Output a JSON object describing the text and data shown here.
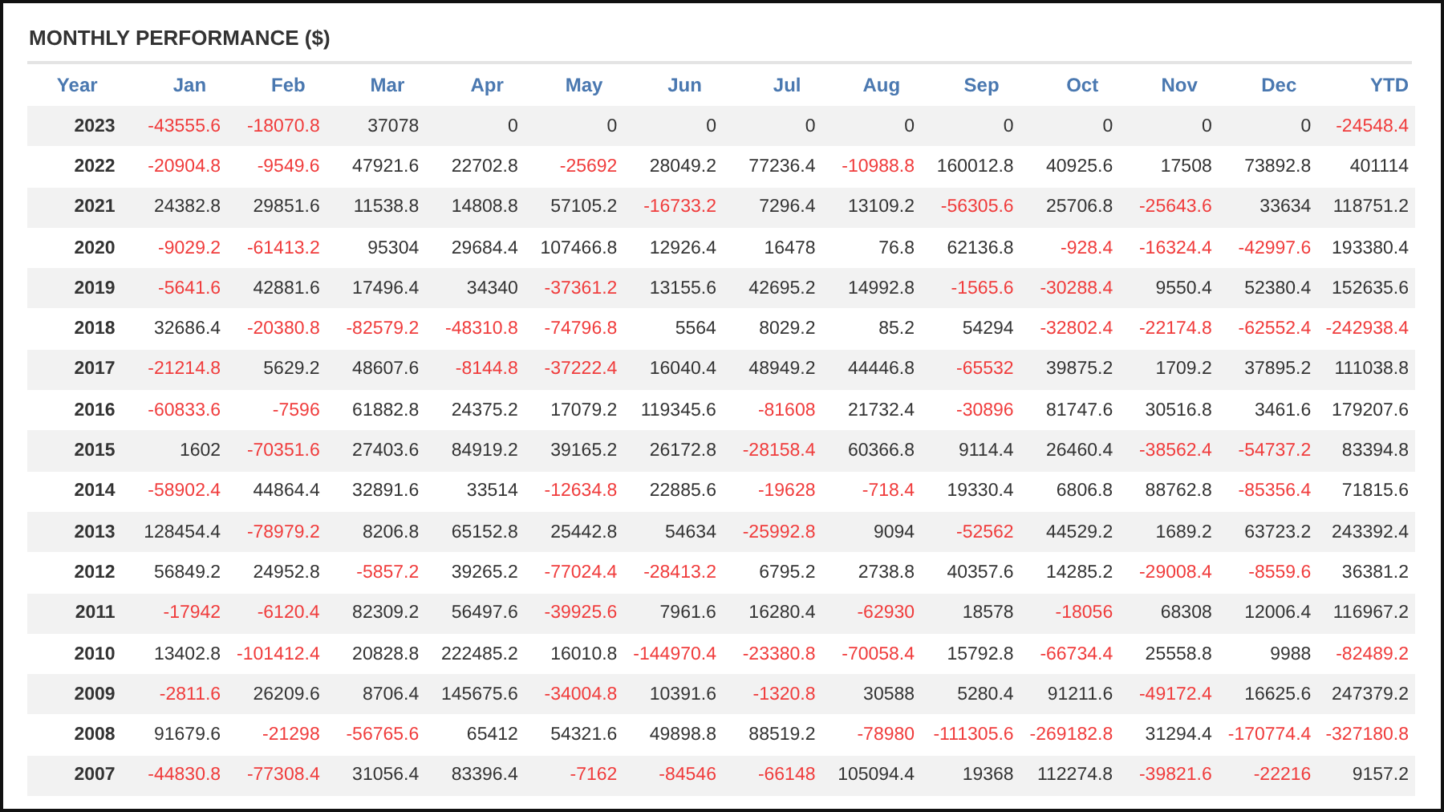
{
  "title": "MONTHLY PERFORMANCE ($)",
  "columns": [
    "Year",
    "Jan",
    "Feb",
    "Mar",
    "Apr",
    "May",
    "Jun",
    "Jul",
    "Aug",
    "Sep",
    "Oct",
    "Nov",
    "Dec",
    "YTD"
  ],
  "rows": [
    {
      "year": "2023",
      "cells": [
        {
          "value": "-43555.6",
          "negative": true
        },
        {
          "value": "-18070.8",
          "negative": true
        },
        {
          "value": "37078",
          "negative": false
        },
        {
          "value": "0",
          "negative": false
        },
        {
          "value": "0",
          "negative": false
        },
        {
          "value": "0",
          "negative": false
        },
        {
          "value": "0",
          "negative": false
        },
        {
          "value": "0",
          "negative": false
        },
        {
          "value": "0",
          "negative": false
        },
        {
          "value": "0",
          "negative": false
        },
        {
          "value": "0",
          "negative": false
        },
        {
          "value": "0",
          "negative": false
        },
        {
          "value": "-24548.4",
          "negative": true
        }
      ]
    },
    {
      "year": "2022",
      "cells": [
        {
          "value": "-20904.8",
          "negative": true
        },
        {
          "value": "-9549.6",
          "negative": true
        },
        {
          "value": "47921.6",
          "negative": false
        },
        {
          "value": "22702.8",
          "negative": false
        },
        {
          "value": "-25692",
          "negative": true
        },
        {
          "value": "28049.2",
          "negative": false
        },
        {
          "value": "77236.4",
          "negative": false
        },
        {
          "value": "-10988.8",
          "negative": true
        },
        {
          "value": "160012.8",
          "negative": false
        },
        {
          "value": "40925.6",
          "negative": false
        },
        {
          "value": "17508",
          "negative": false
        },
        {
          "value": "73892.8",
          "negative": false
        },
        {
          "value": "401114",
          "negative": false
        }
      ]
    },
    {
      "year": "2021",
      "cells": [
        {
          "value": "24382.8",
          "negative": false
        },
        {
          "value": "29851.6",
          "negative": false
        },
        {
          "value": "11538.8",
          "negative": false
        },
        {
          "value": "14808.8",
          "negative": false
        },
        {
          "value": "57105.2",
          "negative": false
        },
        {
          "value": "-16733.2",
          "negative": true
        },
        {
          "value": "7296.4",
          "negative": false
        },
        {
          "value": "13109.2",
          "negative": false
        },
        {
          "value": "-56305.6",
          "negative": true
        },
        {
          "value": "25706.8",
          "negative": false
        },
        {
          "value": "-25643.6",
          "negative": true
        },
        {
          "value": "33634",
          "negative": false
        },
        {
          "value": "118751.2",
          "negative": false
        }
      ]
    },
    {
      "year": "2020",
      "cells": [
        {
          "value": "-9029.2",
          "negative": true
        },
        {
          "value": "-61413.2",
          "negative": true
        },
        {
          "value": "95304",
          "negative": false
        },
        {
          "value": "29684.4",
          "negative": false
        },
        {
          "value": "107466.8",
          "negative": false
        },
        {
          "value": "12926.4",
          "negative": false
        },
        {
          "value": "16478",
          "negative": false
        },
        {
          "value": "76.8",
          "negative": false
        },
        {
          "value": "62136.8",
          "negative": false
        },
        {
          "value": "-928.4",
          "negative": true
        },
        {
          "value": "-16324.4",
          "negative": true
        },
        {
          "value": "-42997.6",
          "negative": true
        },
        {
          "value": "193380.4",
          "negative": false
        }
      ]
    },
    {
      "year": "2019",
      "cells": [
        {
          "value": "-5641.6",
          "negative": true
        },
        {
          "value": "42881.6",
          "negative": false
        },
        {
          "value": "17496.4",
          "negative": false
        },
        {
          "value": "34340",
          "negative": false
        },
        {
          "value": "-37361.2",
          "negative": true
        },
        {
          "value": "13155.6",
          "negative": false
        },
        {
          "value": "42695.2",
          "negative": false
        },
        {
          "value": "14992.8",
          "negative": false
        },
        {
          "value": "-1565.6",
          "negative": true
        },
        {
          "value": "-30288.4",
          "negative": true
        },
        {
          "value": "9550.4",
          "negative": false
        },
        {
          "value": "52380.4",
          "negative": false
        },
        {
          "value": "152635.6",
          "negative": false
        }
      ]
    },
    {
      "year": "2018",
      "cells": [
        {
          "value": "32686.4",
          "negative": false
        },
        {
          "value": "-20380.8",
          "negative": true
        },
        {
          "value": "-82579.2",
          "negative": true
        },
        {
          "value": "-48310.8",
          "negative": true
        },
        {
          "value": "-74796.8",
          "negative": true
        },
        {
          "value": "5564",
          "negative": false
        },
        {
          "value": "8029.2",
          "negative": false
        },
        {
          "value": "85.2",
          "negative": false
        },
        {
          "value": "54294",
          "negative": false
        },
        {
          "value": "-32802.4",
          "negative": true
        },
        {
          "value": "-22174.8",
          "negative": true
        },
        {
          "value": "-62552.4",
          "negative": true
        },
        {
          "value": "-242938.4",
          "negative": true
        }
      ]
    },
    {
      "year": "2017",
      "cells": [
        {
          "value": "-21214.8",
          "negative": true
        },
        {
          "value": "5629.2",
          "negative": false
        },
        {
          "value": "48607.6",
          "negative": false
        },
        {
          "value": "-8144.8",
          "negative": true
        },
        {
          "value": "-37222.4",
          "negative": true
        },
        {
          "value": "16040.4",
          "negative": false
        },
        {
          "value": "48949.2",
          "negative": false
        },
        {
          "value": "44446.8",
          "negative": false
        },
        {
          "value": "-65532",
          "negative": true
        },
        {
          "value": "39875.2",
          "negative": false
        },
        {
          "value": "1709.2",
          "negative": false
        },
        {
          "value": "37895.2",
          "negative": false
        },
        {
          "value": "111038.8",
          "negative": false
        }
      ]
    },
    {
      "year": "2016",
      "cells": [
        {
          "value": "-60833.6",
          "negative": true
        },
        {
          "value": "-7596",
          "negative": true
        },
        {
          "value": "61882.8",
          "negative": false
        },
        {
          "value": "24375.2",
          "negative": false
        },
        {
          "value": "17079.2",
          "negative": false
        },
        {
          "value": "119345.6",
          "negative": false
        },
        {
          "value": "-81608",
          "negative": true
        },
        {
          "value": "21732.4",
          "negative": false
        },
        {
          "value": "-30896",
          "negative": true
        },
        {
          "value": "81747.6",
          "negative": false
        },
        {
          "value": "30516.8",
          "negative": false
        },
        {
          "value": "3461.6",
          "negative": false
        },
        {
          "value": "179207.6",
          "negative": false
        }
      ]
    },
    {
      "year": "2015",
      "cells": [
        {
          "value": "1602",
          "negative": false
        },
        {
          "value": "-70351.6",
          "negative": true
        },
        {
          "value": "27403.6",
          "negative": false
        },
        {
          "value": "84919.2",
          "negative": false
        },
        {
          "value": "39165.2",
          "negative": false
        },
        {
          "value": "26172.8",
          "negative": false
        },
        {
          "value": "-28158.4",
          "negative": true
        },
        {
          "value": "60366.8",
          "negative": false
        },
        {
          "value": "9114.4",
          "negative": false
        },
        {
          "value": "26460.4",
          "negative": false
        },
        {
          "value": "-38562.4",
          "negative": true
        },
        {
          "value": "-54737.2",
          "negative": true
        },
        {
          "value": "83394.8",
          "negative": false
        }
      ]
    },
    {
      "year": "2014",
      "cells": [
        {
          "value": "-58902.4",
          "negative": true
        },
        {
          "value": "44864.4",
          "negative": false
        },
        {
          "value": "32891.6",
          "negative": false
        },
        {
          "value": "33514",
          "negative": false
        },
        {
          "value": "-12634.8",
          "negative": true
        },
        {
          "value": "22885.6",
          "negative": false
        },
        {
          "value": "-19628",
          "negative": true
        },
        {
          "value": "-718.4",
          "negative": true
        },
        {
          "value": "19330.4",
          "negative": false
        },
        {
          "value": "6806.8",
          "negative": false
        },
        {
          "value": "88762.8",
          "negative": false
        },
        {
          "value": "-85356.4",
          "negative": true
        },
        {
          "value": "71815.6",
          "negative": false
        }
      ]
    },
    {
      "year": "2013",
      "cells": [
        {
          "value": "128454.4",
          "negative": false
        },
        {
          "value": "-78979.2",
          "negative": true
        },
        {
          "value": "8206.8",
          "negative": false
        },
        {
          "value": "65152.8",
          "negative": false
        },
        {
          "value": "25442.8",
          "negative": false
        },
        {
          "value": "54634",
          "negative": false
        },
        {
          "value": "-25992.8",
          "negative": true
        },
        {
          "value": "9094",
          "negative": false
        },
        {
          "value": "-52562",
          "negative": true
        },
        {
          "value": "44529.2",
          "negative": false
        },
        {
          "value": "1689.2",
          "negative": false
        },
        {
          "value": "63723.2",
          "negative": false
        },
        {
          "value": "243392.4",
          "negative": false
        }
      ]
    },
    {
      "year": "2012",
      "cells": [
        {
          "value": "56849.2",
          "negative": false
        },
        {
          "value": "24952.8",
          "negative": false
        },
        {
          "value": "-5857.2",
          "negative": true
        },
        {
          "value": "39265.2",
          "negative": false
        },
        {
          "value": "-77024.4",
          "negative": true
        },
        {
          "value": "-28413.2",
          "negative": true
        },
        {
          "value": "6795.2",
          "negative": false
        },
        {
          "value": "2738.8",
          "negative": false
        },
        {
          "value": "40357.6",
          "negative": false
        },
        {
          "value": "14285.2",
          "negative": false
        },
        {
          "value": "-29008.4",
          "negative": true
        },
        {
          "value": "-8559.6",
          "negative": true
        },
        {
          "value": "36381.2",
          "negative": false
        }
      ]
    },
    {
      "year": "2011",
      "cells": [
        {
          "value": "-17942",
          "negative": true
        },
        {
          "value": "-6120.4",
          "negative": true
        },
        {
          "value": "82309.2",
          "negative": false
        },
        {
          "value": "56497.6",
          "negative": false
        },
        {
          "value": "-39925.6",
          "negative": true
        },
        {
          "value": "7961.6",
          "negative": false
        },
        {
          "value": "16280.4",
          "negative": false
        },
        {
          "value": "-62930",
          "negative": true
        },
        {
          "value": "18578",
          "negative": false
        },
        {
          "value": "-18056",
          "negative": true
        },
        {
          "value": "68308",
          "negative": false
        },
        {
          "value": "12006.4",
          "negative": false
        },
        {
          "value": "116967.2",
          "negative": false
        }
      ]
    },
    {
      "year": "2010",
      "cells": [
        {
          "value": "13402.8",
          "negative": false
        },
        {
          "value": "-101412.4",
          "negative": true
        },
        {
          "value": "20828.8",
          "negative": false
        },
        {
          "value": "222485.2",
          "negative": false
        },
        {
          "value": "16010.8",
          "negative": false
        },
        {
          "value": "-144970.4",
          "negative": true
        },
        {
          "value": "-23380.8",
          "negative": true
        },
        {
          "value": "-70058.4",
          "negative": true
        },
        {
          "value": "15792.8",
          "negative": false
        },
        {
          "value": "-66734.4",
          "negative": true
        },
        {
          "value": "25558.8",
          "negative": false
        },
        {
          "value": "9988",
          "negative": false
        },
        {
          "value": "-82489.2",
          "negative": true
        }
      ]
    },
    {
      "year": "2009",
      "cells": [
        {
          "value": "-2811.6",
          "negative": true
        },
        {
          "value": "26209.6",
          "negative": false
        },
        {
          "value": "8706.4",
          "negative": false
        },
        {
          "value": "145675.6",
          "negative": false
        },
        {
          "value": "-34004.8",
          "negative": true
        },
        {
          "value": "10391.6",
          "negative": false
        },
        {
          "value": "-1320.8",
          "negative": true
        },
        {
          "value": "30588",
          "negative": false
        },
        {
          "value": "5280.4",
          "negative": false
        },
        {
          "value": "91211.6",
          "negative": false
        },
        {
          "value": "-49172.4",
          "negative": true
        },
        {
          "value": "16625.6",
          "negative": false
        },
        {
          "value": "247379.2",
          "negative": false
        }
      ]
    },
    {
      "year": "2008",
      "cells": [
        {
          "value": "91679.6",
          "negative": false
        },
        {
          "value": "-21298",
          "negative": true
        },
        {
          "value": "-56765.6",
          "negative": true
        },
        {
          "value": "65412",
          "negative": false
        },
        {
          "value": "54321.6",
          "negative": false
        },
        {
          "value": "49898.8",
          "negative": false
        },
        {
          "value": "88519.2",
          "negative": false
        },
        {
          "value": "-78980",
          "negative": true
        },
        {
          "value": "-111305.6",
          "negative": true
        },
        {
          "value": "-269182.8",
          "negative": true
        },
        {
          "value": "31294.4",
          "negative": false
        },
        {
          "value": "-170774.4",
          "negative": true
        },
        {
          "value": "-327180.8",
          "negative": true
        }
      ]
    },
    {
      "year": "2007",
      "cells": [
        {
          "value": "-44830.8",
          "negative": true
        },
        {
          "value": "-77308.4",
          "negative": true
        },
        {
          "value": "31056.4",
          "negative": false
        },
        {
          "value": "83396.4",
          "negative": false
        },
        {
          "value": "-7162",
          "negative": true
        },
        {
          "value": "-84546",
          "negative": true
        },
        {
          "value": "-66148",
          "negative": true
        },
        {
          "value": "105094.4",
          "negative": false
        },
        {
          "value": "19368",
          "negative": false
        },
        {
          "value": "112274.8",
          "negative": false
        },
        {
          "value": "-39821.6",
          "negative": true
        },
        {
          "value": "-22216",
          "negative": true
        },
        {
          "value": "9157.2",
          "negative": false
        }
      ]
    }
  ]
}
